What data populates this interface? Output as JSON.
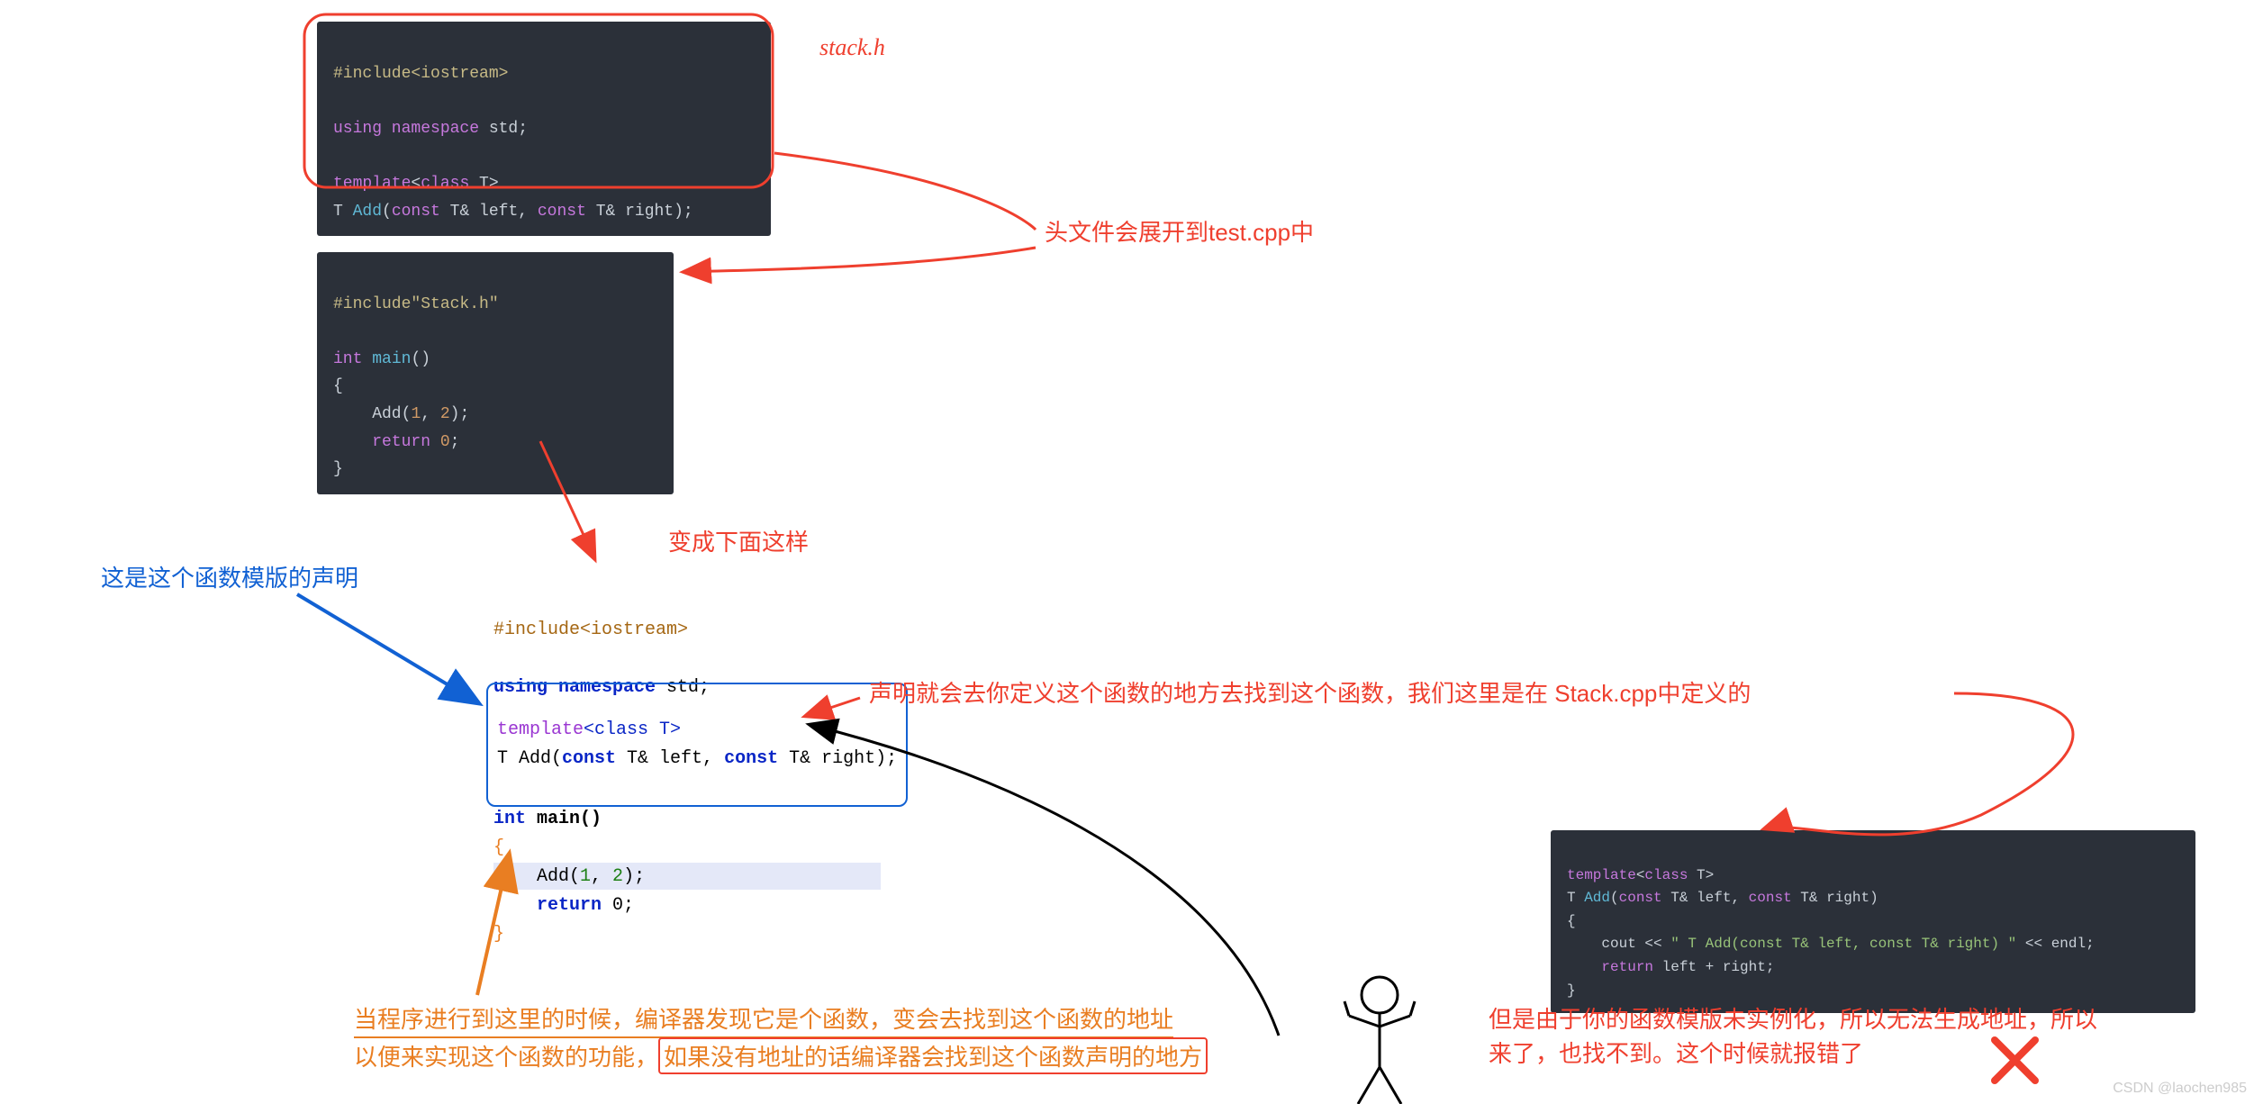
{
  "blocks": {
    "stackh": {
      "line1": "#include<iostream>",
      "line2_kw": "using namespace",
      "line2_rest": " std;",
      "line3_a": "template",
      "line3_b": "<",
      "line3_c": "class",
      "line3_d": " T>",
      "line4_a": "T ",
      "line4_b": "Add",
      "line4_c": "(",
      "line4_d": "const",
      "line4_e": " T& left, ",
      "line4_f": "const",
      "line4_g": " T& right);"
    },
    "testcpp": {
      "line1": "#include\"Stack.h\"",
      "line2_a": "int ",
      "line2_b": "main",
      "line2_c": "()",
      "line3": "{",
      "line4_a": "    Add",
      "line4_b": "(",
      "line4_c": "1",
      "line4_d": ", ",
      "line4_e": "2",
      "line4_f": ");",
      "line5_a": "    return ",
      "line5_b": "0",
      "line5_c": ";",
      "line6": "}"
    },
    "expanded": {
      "l1": "#include<iostream>",
      "l2a": "using namespace ",
      "l2b": "std;",
      "l3a": "template",
      "l3b": "<class T>",
      "l4a": "T Add(",
      "l4b": "const ",
      "l4c": "T& left, ",
      "l4d": "const ",
      "l4e": "T& right);",
      "l5a": "int ",
      "l5b": "main",
      "l5c": "()",
      "l6": "{",
      "l7a": "    Add(",
      "l7b": "1",
      "l7c": ", ",
      "l7d": "2",
      "l7e": ");",
      "l8a": "    return ",
      "l8b": "0;",
      "l9": "}"
    },
    "stackcpp": {
      "l1a": "template",
      "l1b": "<",
      "l1c": "class",
      "l1d": " T>",
      "l2a": "T ",
      "l2b": "Add",
      "l2c": "(",
      "l2d": "const",
      "l2e": " T& left, ",
      "l2f": "const",
      "l2g": " T& right)",
      "l3": "{",
      "l4a": "    cout << ",
      "l4b": "\" T Add(const T& left, const T& right) \"",
      "l4c": " << endl;",
      "l5a": "    return",
      "l5b": " left + right;",
      "l6": "}"
    }
  },
  "annotations": {
    "stackh_label": "stack.h",
    "header_expand": "头文件会展开到test.cpp中",
    "become": "变成下面这样",
    "decl_label": "这是这个函数模版的声明",
    "goto_def": "声明就会去你定义这个函数的地方去找到这个函数，我们这里是在 Stack.cpp中定义的",
    "orange_l1": "当程序进行到这里的时候，编译器发现它是个函数，变会去找到这个函数的地址",
    "orange_l2a": "以便来实现这个函数的功能，",
    "orange_l2b": "如果没有地址的话编译器会找到这个函数声明的地方",
    "red_fail_l1": "但是由于你的函数模版未实例化，所以无法生成地址，所以",
    "red_fail_l2": "来了，也找不到。这个时候就报错了"
  },
  "watermark": "CSDN @laochen985"
}
